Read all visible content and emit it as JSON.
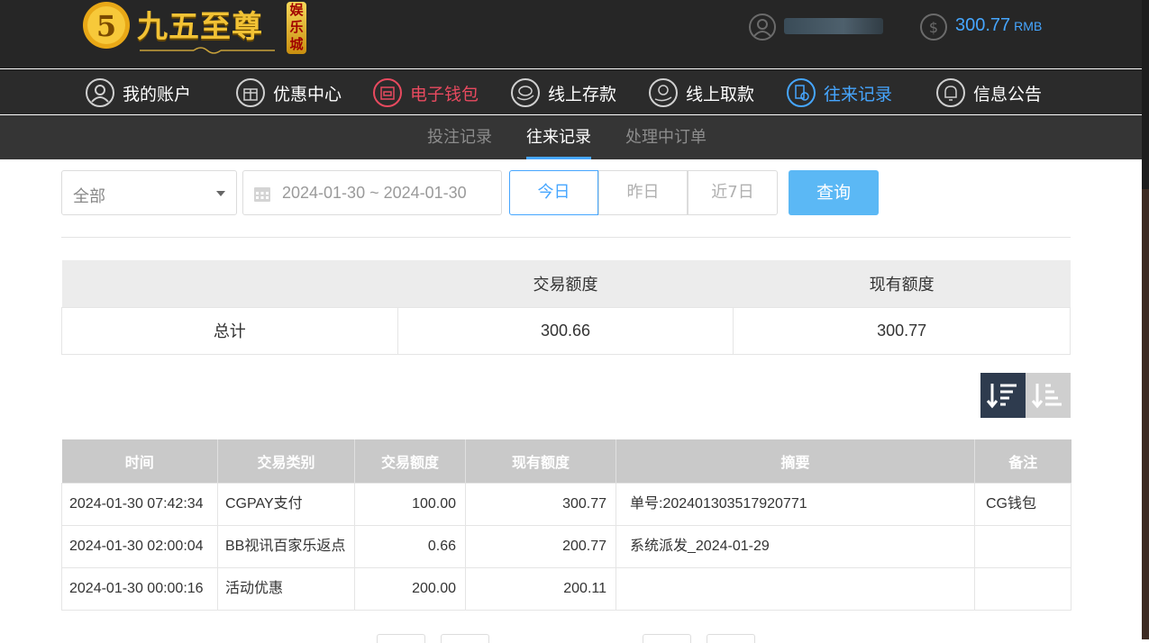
{
  "brand": {
    "logo_text": "九五至尊",
    "badge_text": "娱乐城"
  },
  "account": {
    "balance_amount": "300.77",
    "balance_unit": "RMB"
  },
  "nav": {
    "items": [
      {
        "label": "我的账户",
        "icon": "user-circle-icon"
      },
      {
        "label": "优惠中心",
        "icon": "gift-icon"
      },
      {
        "label": "电子钱包",
        "icon": "wallet-icon"
      },
      {
        "label": "线上存款",
        "icon": "deposit-icon"
      },
      {
        "label": "线上取款",
        "icon": "withdraw-icon"
      },
      {
        "label": "往来记录",
        "icon": "records-icon"
      },
      {
        "label": "信息公告",
        "icon": "bell-icon"
      }
    ],
    "active_index": 5
  },
  "subnav": {
    "items": [
      "投注记录",
      "往来记录",
      "处理中订单"
    ],
    "active_index": 1
  },
  "filters": {
    "type_value": "全部",
    "date_range": "2024-01-30 ~ 2024-01-30",
    "quick_ranges": [
      "今日",
      "昨日",
      "近7日"
    ],
    "quick_active": "今日",
    "query_label": "查询"
  },
  "summary": {
    "headers": [
      "",
      "交易额度",
      "现有额度"
    ],
    "row_label": "总计",
    "trade_amount": "300.66",
    "current_amount": "300.77"
  },
  "records": {
    "headers": [
      "时间",
      "交易类别",
      "交易额度",
      "现有额度",
      "摘要",
      "备注"
    ],
    "rows": [
      {
        "time": "2024-01-30 07:42:34",
        "type": "CGPAY支付",
        "amount": "100.00",
        "balance": "300.77",
        "summary": "单号:202401303517920771",
        "note": "CG钱包"
      },
      {
        "time": "2024-01-30 02:00:04",
        "type": "BB视讯百家乐返点",
        "amount": "0.66",
        "balance": "200.77",
        "summary": "系统派发_2024-01-29",
        "note": ""
      },
      {
        "time": "2024-01-30 00:00:16",
        "type": "活动优惠",
        "amount": "200.00",
        "balance": "200.11",
        "summary": "",
        "note": ""
      }
    ]
  },
  "colors": {
    "accent_blue": "#46a6ff",
    "accent_red": "#e84a5f",
    "topbar_bg": "#262626",
    "logo_gold": "#f2c235"
  }
}
